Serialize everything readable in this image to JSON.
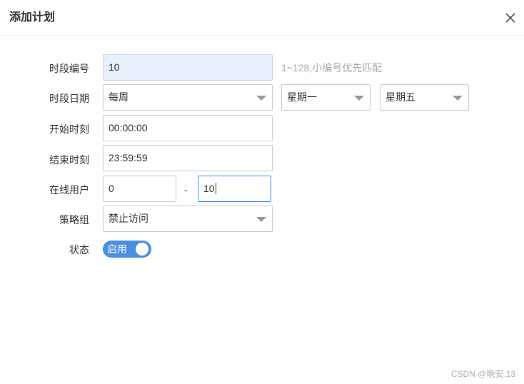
{
  "dialog": {
    "title": "添加计划",
    "close_icon": "close-icon"
  },
  "form": {
    "segment_no": {
      "label": "时段编号",
      "value": "10",
      "hint": "1~128,小编号优先匹配"
    },
    "segment_date": {
      "label": "时段日期",
      "period": "每周",
      "start_day": "星期一",
      "end_day": "星期五"
    },
    "start_time": {
      "label": "开始时刻",
      "value": "00:00:00"
    },
    "end_time": {
      "label": "结束时刻",
      "value": "23:59:59"
    },
    "online_users": {
      "label": "在线用户",
      "min": "0",
      "separator": "-",
      "max": "10"
    },
    "policy_group": {
      "label": "策略组",
      "value": "禁止访问"
    },
    "status": {
      "label": "状态",
      "toggle_label": "启用",
      "enabled": true
    }
  },
  "watermark": "CSDN @晩安.13",
  "colors": {
    "accent": "#4a90e2",
    "highlight_bg": "#e8f0fe",
    "hint": "#aaaaaa"
  }
}
